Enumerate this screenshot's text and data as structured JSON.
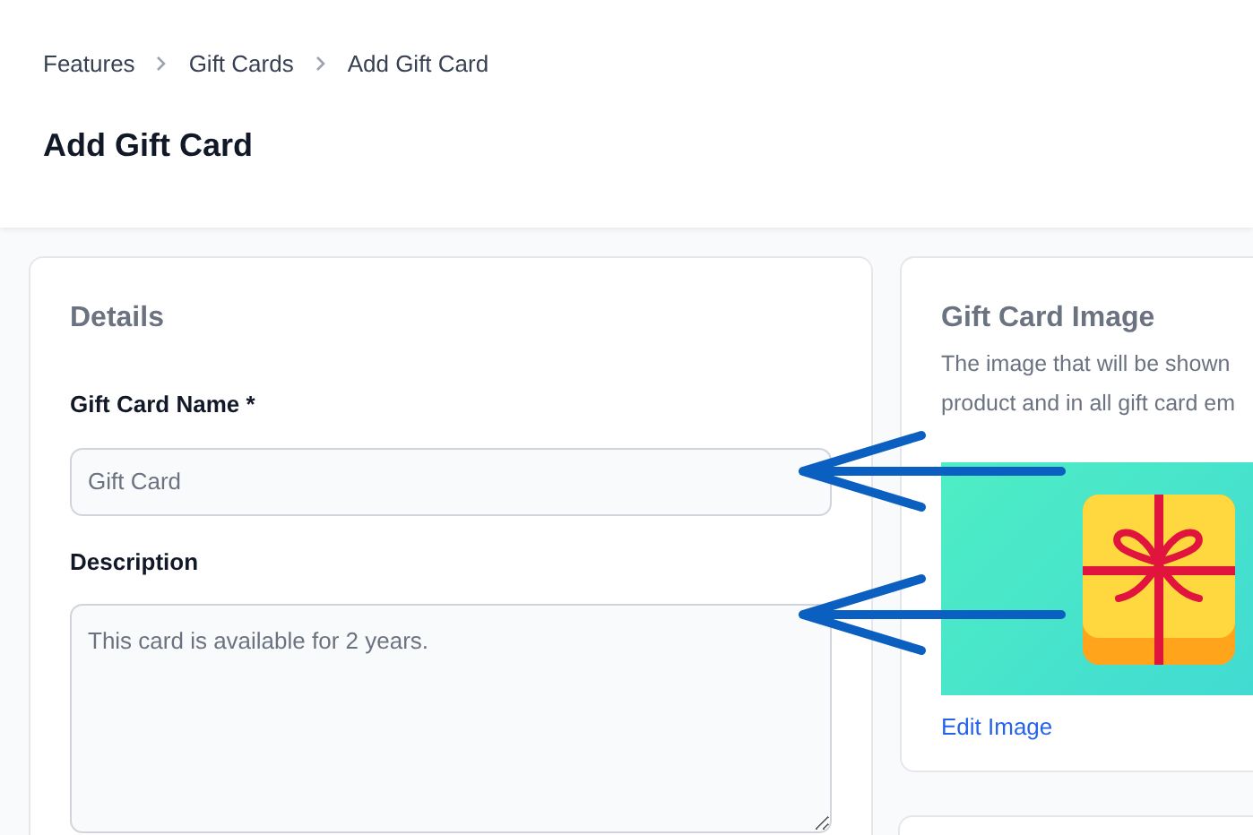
{
  "breadcrumb": [
    {
      "label": "Features"
    },
    {
      "label": "Gift Cards"
    },
    {
      "label": "Add Gift Card"
    }
  ],
  "page_title": "Add Gift Card",
  "details_card": {
    "title": "Details",
    "fields": [
      {
        "kind": "input",
        "label": "Gift Card Name *",
        "placeholder": "Gift Card"
      },
      {
        "kind": "textarea",
        "label": "Description",
        "placeholder": "This card is available for 2 years."
      }
    ]
  },
  "image_card": {
    "title": "Gift Card Image",
    "description_lines": [
      "The image that will be shown",
      "product and in all gift card em"
    ],
    "edit_link": "Edit Image"
  }
}
